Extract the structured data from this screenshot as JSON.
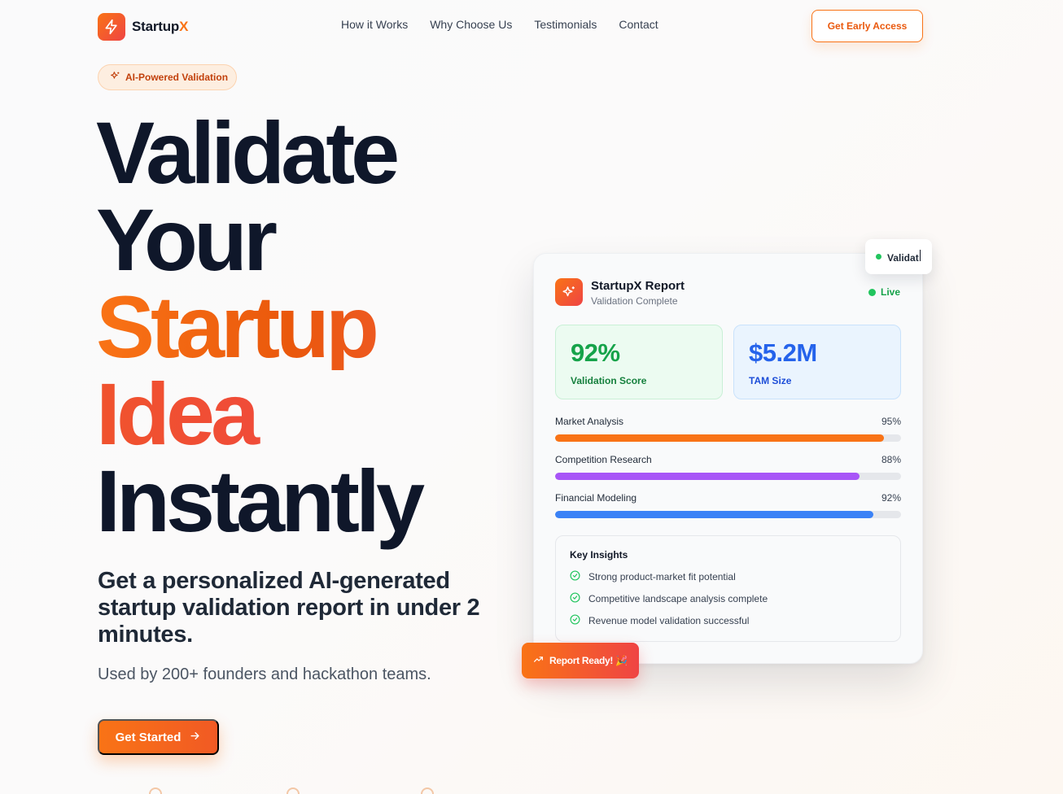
{
  "nav": {
    "logo_text": "Startup",
    "logo_accent": "X",
    "links": [
      "How it Works",
      "Why Choose Us",
      "Testimonials",
      "Contact"
    ],
    "cta": "Get Early Access"
  },
  "hero": {
    "badge": "AI-Powered Validation",
    "headline": [
      "Validate",
      "Your",
      "Startup",
      "Idea",
      "Instantly"
    ],
    "subhead": "Get a personalized AI-generated startup validation report in under 2 minutes.",
    "used_by": "Used by 200+ founders and hackathon teams.",
    "cta": "Get Started"
  },
  "report": {
    "title": "StartupX Report",
    "subtitle": "Validation Complete",
    "status": "Live",
    "stats": [
      {
        "value": "92%",
        "label": "Validation Score"
      },
      {
        "value": "$5.2M",
        "label": "TAM Size"
      }
    ],
    "bars": [
      {
        "label": "Market Analysis",
        "pct_text": "95%",
        "value": 95,
        "color": "#f97316"
      },
      {
        "label": "Competition Research",
        "pct_text": "88%",
        "value": 88,
        "color": "#a855f7"
      },
      {
        "label": "Financial Modeling",
        "pct_text": "92%",
        "value": 92,
        "color": "#3b82f6"
      }
    ],
    "insights_title": "Key Insights",
    "insights": [
      "Strong product-market fit potential",
      "Competitive landscape analysis complete",
      "Revenue model validation successful"
    ],
    "float_status": "Validat",
    "float_ready": "Report Ready! 🎉"
  },
  "colors": {
    "accent": "#f97316",
    "accent_red": "#ef4444",
    "success": "#16a34a",
    "info": "#2563eb"
  }
}
